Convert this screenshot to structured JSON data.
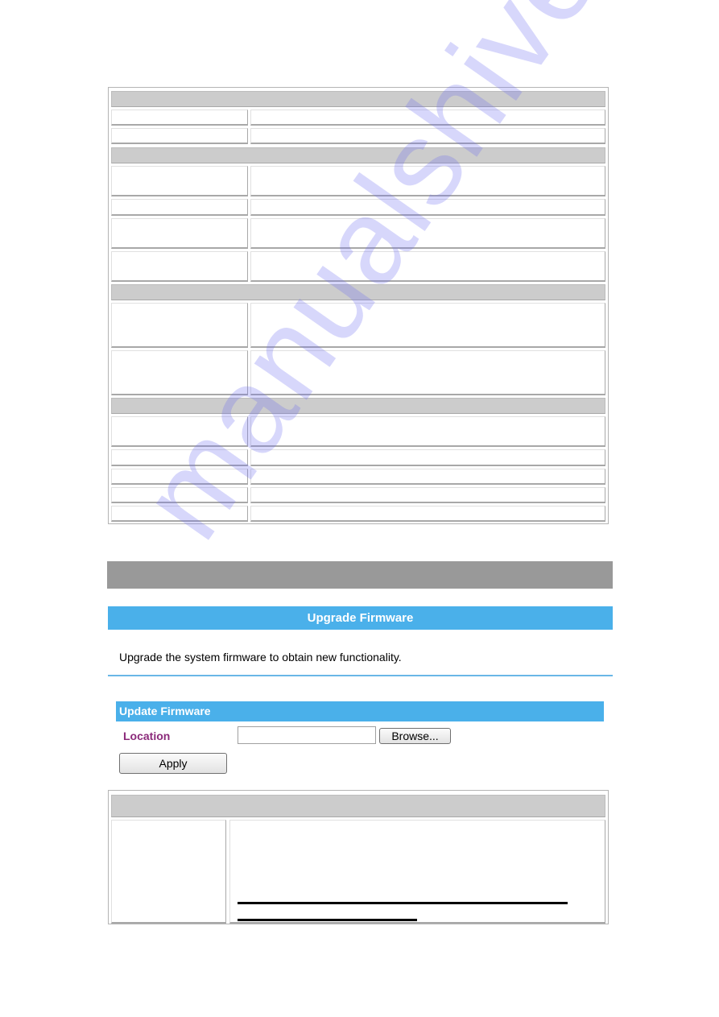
{
  "watermark": "manualshive.com",
  "upgrade_firmware": {
    "title": "Upgrade Firmware",
    "description": "Upgrade the system firmware to obtain new functionality.",
    "section_title": "Update Firmware",
    "location_label": "Location",
    "location_value": "",
    "browse_label": "Browse...",
    "apply_label": "Apply"
  },
  "colors": {
    "accent_blue": "#4ab0ea",
    "header_gray": "#cccccc",
    "bar_gray": "#999999",
    "label_purple": "#8b2a7a"
  }
}
